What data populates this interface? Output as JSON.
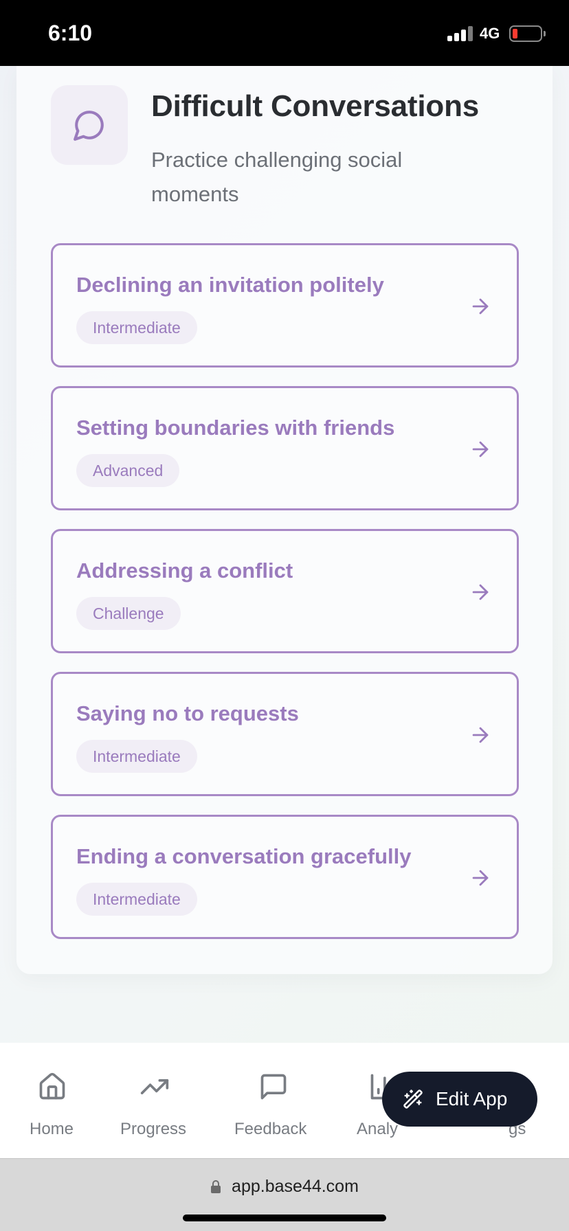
{
  "status_bar": {
    "time": "6:10",
    "network": "4G"
  },
  "header": {
    "icon": "message-circle-icon",
    "title": "Difficult Conversations",
    "subtitle": "Practice challenging social moments"
  },
  "scenarios": [
    {
      "title": "Declining an invitation politely",
      "level": "Intermediate"
    },
    {
      "title": "Setting boundaries with friends",
      "level": "Advanced"
    },
    {
      "title": "Addressing a conflict",
      "level": "Challenge"
    },
    {
      "title": "Saying no to requests",
      "level": "Intermediate"
    },
    {
      "title": "Ending a conversation gracefully",
      "level": "Intermediate"
    }
  ],
  "nav": {
    "items": [
      {
        "label": "Home",
        "icon": "home-icon"
      },
      {
        "label": "Progress",
        "icon": "trending-up-icon"
      },
      {
        "label": "Feedback",
        "icon": "message-square-icon"
      },
      {
        "label": "Analy",
        "icon": "bar-chart-icon"
      },
      {
        "label": "gs",
        "icon": "settings-icon"
      }
    ]
  },
  "edit_app": {
    "label": "Edit App",
    "icon": "wand-sparkles-icon"
  },
  "browser": {
    "url": "app.base44.com"
  },
  "colors": {
    "accent": "#a889c6",
    "accent_text": "#9a7bbd",
    "badge_bg": "#f1eef6",
    "edit_button": "#151b2b"
  }
}
